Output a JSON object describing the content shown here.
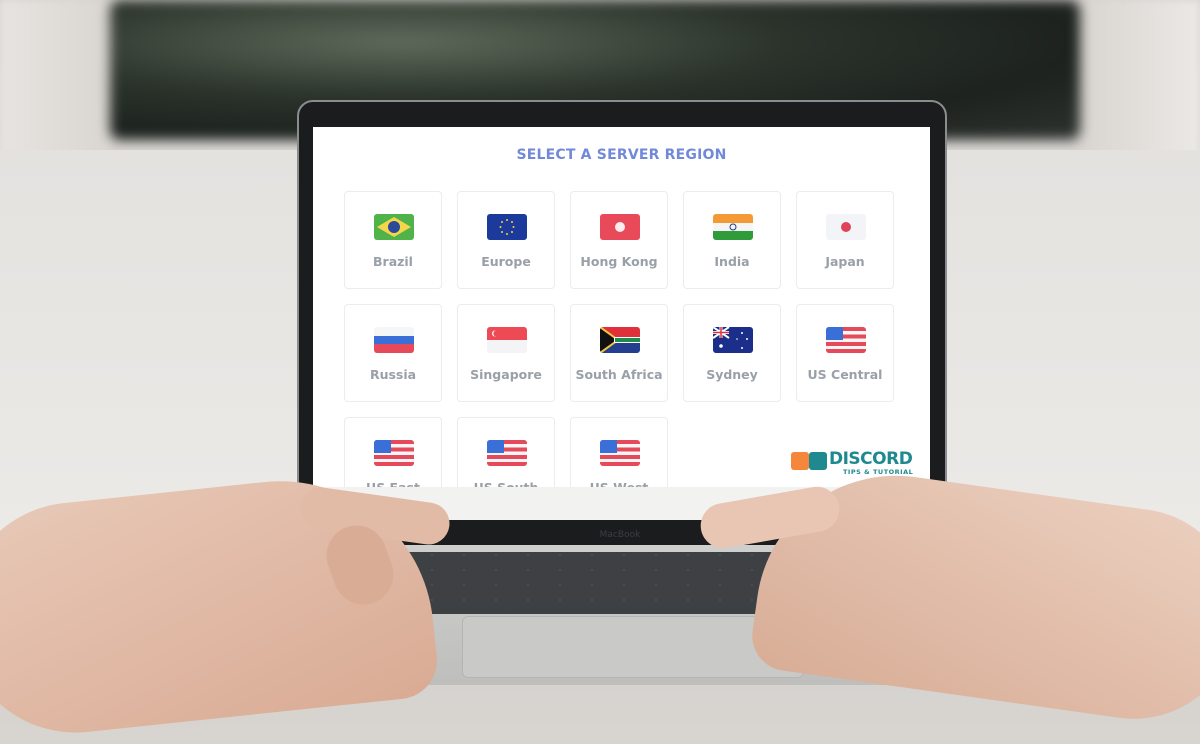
{
  "dialog": {
    "title": "SELECT A SERVER REGION",
    "regions": [
      {
        "label": "Brazil",
        "flag": "brazil-flag"
      },
      {
        "label": "Europe",
        "flag": "eu-flag"
      },
      {
        "label": "Hong Kong",
        "flag": "hong-kong-flag"
      },
      {
        "label": "India",
        "flag": "india-flag"
      },
      {
        "label": "Japan",
        "flag": "japan-flag"
      },
      {
        "label": "Russia",
        "flag": "russia-flag"
      },
      {
        "label": "Singapore",
        "flag": "singapore-flag"
      },
      {
        "label": "South Africa",
        "flag": "south-africa-flag"
      },
      {
        "label": "Sydney",
        "flag": "australia-flag"
      },
      {
        "label": "US Central",
        "flag": "us-flag"
      },
      {
        "label": "US East",
        "flag": "us-flag"
      },
      {
        "label": "US South",
        "flag": "us-flag"
      },
      {
        "label": "US West",
        "flag": "us-flag"
      }
    ]
  },
  "watermark": {
    "brand": "DISCORD",
    "tagline": "TIPS & TUTORIAL"
  },
  "laptop": {
    "brand": "MacBook"
  },
  "colors": {
    "title": "#7289da",
    "label": "#99a0a8",
    "watermark_teal": "#1e8a8f",
    "watermark_orange": "#f5873a"
  }
}
